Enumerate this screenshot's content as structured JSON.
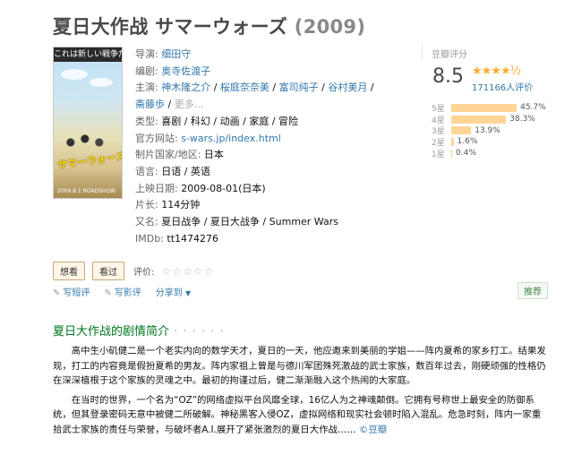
{
  "title": {
    "main": "夏日大作战 サマーウォーズ",
    "year": "(2009)"
  },
  "poster": {
    "top_text": "これは新しい戦争だ",
    "mid_text": "サマーウォーズ",
    "bottom_text": "2009.8.1 ROADSHOW"
  },
  "info": {
    "director_label": "导演:",
    "director": "细田守",
    "writer_label": "编剧:",
    "writer": "奥寺佐渡子",
    "cast_label": "主演:",
    "cast": [
      "神木隆之介",
      "桜庭奈奈美",
      "富司纯子",
      "谷村美月",
      "斋藤歩"
    ],
    "cast_more": "更多...",
    "genre_label": "类型:",
    "genre": "喜剧 / 科幻 / 动画 / 家庭 / 冒险",
    "site_label": "官方网站:",
    "site": "s-wars.jp/index.html",
    "country_label": "制片国家/地区:",
    "country": "日本",
    "language_label": "语言:",
    "language": "日语 / 英语",
    "release_label": "上映日期:",
    "release": "2009-08-01(日本)",
    "runtime_label": "片长:",
    "runtime": "114分钟",
    "aka_label": "又名:",
    "aka": "夏日战争 / 夏日大战争 / Summer Wars",
    "imdb_label": "IMDb:",
    "imdb": "tt1474276"
  },
  "rating": {
    "label": "豆瓣评分",
    "score": "8.5",
    "stars": "★★★★½",
    "votes": "171166人评价",
    "rows": [
      {
        "label": "5星",
        "pct": "45.7%",
        "value": 45.7
      },
      {
        "label": "4星",
        "pct": "38.3%",
        "value": 38.3
      },
      {
        "label": "3星",
        "pct": "13.9%",
        "value": 13.9
      },
      {
        "label": "2星",
        "pct": "1.6%",
        "value": 1.6
      },
      {
        "label": "1星",
        "pct": "0.4%",
        "value": 0.4
      }
    ]
  },
  "actions": {
    "want": "想看",
    "seen": "看过",
    "rate_label": "评价:",
    "rate_stars": "☆☆☆☆☆"
  },
  "links": {
    "short": "写短评",
    "review": "写影评",
    "share": "分享到",
    "share_caret": "▼",
    "recommend": "推荐"
  },
  "section": {
    "title": "夏日大作战的剧情简介",
    "dots": " · · · · · ·"
  },
  "intro": {
    "p1": "高中生小矶健二是一个老实内向的数学天才，夏日的一天，他应邀来到美丽的学姐——阵内夏希的家乡打工。结果发现，打工的内容竟是假扮夏希的男友。阵内家祖上曾是与德川军团殊死激战的武士家族，数百年过去，刚硬顽强的性格仍在深深植根于这个家族的灵魂之中。最初的拘谨过后，健二渐渐融入这个热闹的大家庭。",
    "p2": "在当时的世界，一个名为“OZ”的网络虚拟平台风靡全球，16亿人为之神魂颠倒。它拥有号称世上最安全的防御系统，但其登录密码无意中被健二所破解。神秘黑客入侵OZ，虚拟网络和现实社会顿时陷入混乱。危急时刻，阵内一家重拾武士家族的责任与荣誉，与破坏者A.I.展开了紧张激烈的夏日大作战……",
    "source": "©豆瓣"
  }
}
